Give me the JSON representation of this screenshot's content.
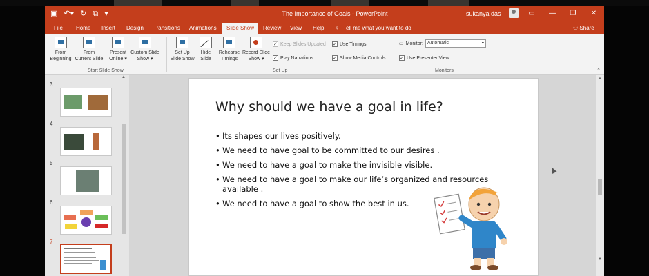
{
  "window": {
    "title": "The Importance of Goals  -  PowerPoint",
    "user": "sukanya das"
  },
  "tabs": [
    {
      "label": "File"
    },
    {
      "label": "Home"
    },
    {
      "label": "Insert"
    },
    {
      "label": "Design"
    },
    {
      "label": "Transitions"
    },
    {
      "label": "Animations"
    },
    {
      "label": "Slide Show",
      "active": true
    },
    {
      "label": "Review"
    },
    {
      "label": "View"
    },
    {
      "label": "Help"
    }
  ],
  "tell_me": "Tell me what you want to do",
  "share": "Share",
  "ribbon": {
    "start_group": {
      "label": "Start Slide Show",
      "from_beginning": [
        "From",
        "Beginning"
      ],
      "from_current": [
        "From",
        "Current Slide"
      ],
      "present_online": [
        "Present",
        "Online ▾"
      ],
      "custom_show": [
        "Custom Slide",
        "Show ▾"
      ]
    },
    "setup_group": {
      "label": "Set Up",
      "setup_show": [
        "Set Up",
        "Slide Show"
      ],
      "hide_slide": [
        "Hide",
        "Slide"
      ],
      "rehearse": [
        "Rehearse",
        "Timings"
      ],
      "record": [
        "Record Slide",
        "Show ▾"
      ],
      "keep_updated": "Keep Slides Updated",
      "play_narrations": "Play Narrations",
      "use_timings": "Use Timings",
      "show_media": "Show Media Controls"
    },
    "monitors_group": {
      "label": "Monitors",
      "monitor_label": "Monitor:",
      "monitor_value": "Automatic",
      "presenter_view": "Use Presenter View"
    }
  },
  "thumbnails": [
    {
      "number": "3"
    },
    {
      "number": "4"
    },
    {
      "number": "5"
    },
    {
      "number": "6"
    },
    {
      "number": "7",
      "selected": true
    }
  ],
  "slide": {
    "title": "Why should we have a goal in life?",
    "bullets": [
      "Its shapes our lives positively.",
      "We need to have goal to be committed to our desires .",
      "We need to have a goal to make the invisible visible.",
      "We need to have a goal to make our life’s organized and resources available .",
      "We need to have a goal to show the best in us."
    ]
  },
  "colors": {
    "accent": "#c43e1c",
    "ribbon_bg": "#f3f3f3",
    "canvas_bg": "#d6d6d6"
  }
}
